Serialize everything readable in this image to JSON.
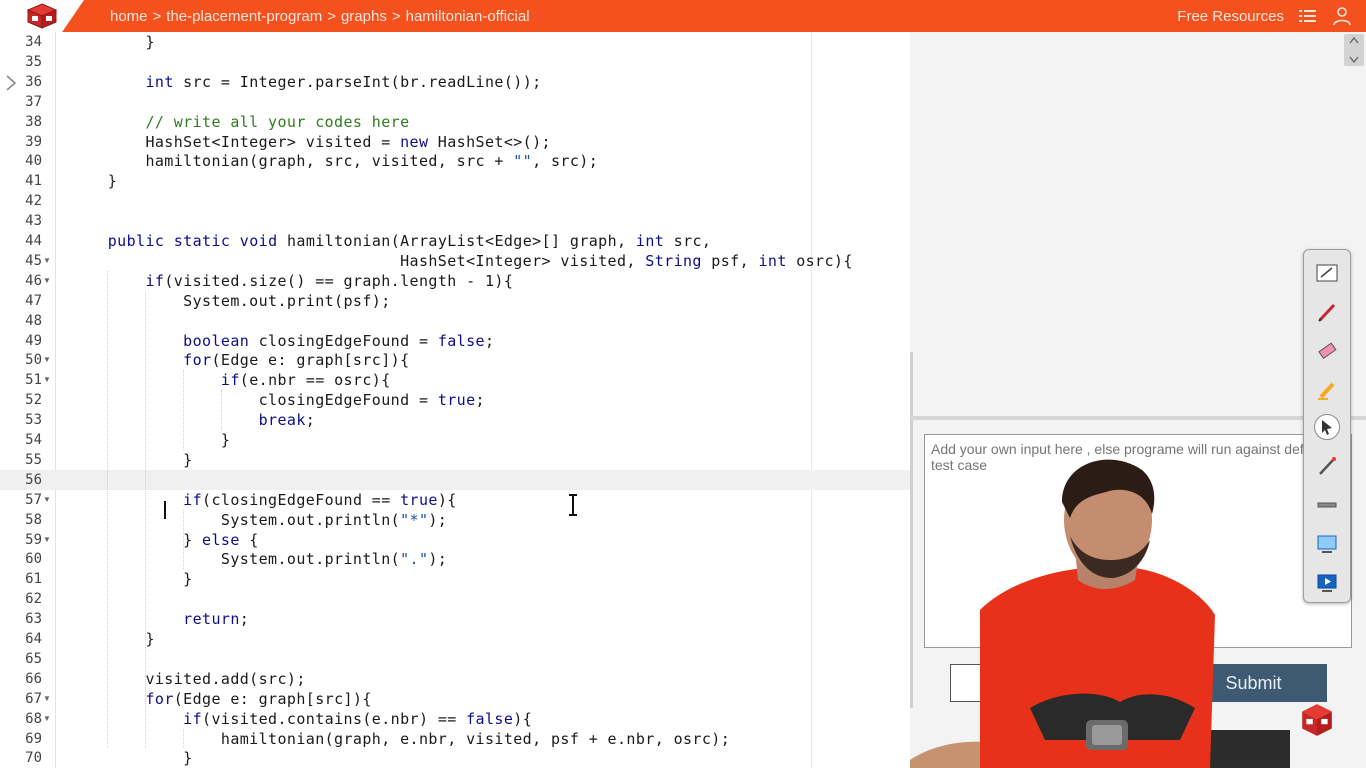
{
  "breadcrumb": {
    "items": [
      "home",
      "the-placement-program",
      "graphs",
      "hamiltonian-official"
    ],
    "separator": ">"
  },
  "header": {
    "free_resources_label": "Free Resources",
    "list_icon": "list-menu-icon",
    "profile_icon": "user-profile-icon",
    "logo_icon": "pepcoding-cube-logo"
  },
  "colors": {
    "topbar": "#f4511e",
    "keyword": "#0d0d8a",
    "comment": "#2e7d1e",
    "string": "#1a4fa8",
    "submit": "#3e5a73"
  },
  "editor": {
    "active_line": 56,
    "lines": [
      {
        "n": "34",
        "text": "        }"
      },
      {
        "n": "35",
        "text": ""
      },
      {
        "n": "36",
        "text": "        int src = Integer.parseInt(br.readLine());"
      },
      {
        "n": "37",
        "text": ""
      },
      {
        "n": "38",
        "text": "        // write all your codes here"
      },
      {
        "n": "39",
        "text": "        HashSet<Integer> visited = new HashSet<>();"
      },
      {
        "n": "40",
        "text": "        hamiltonian(graph, src, visited, src + \"\", src);"
      },
      {
        "n": "41",
        "text": "    }"
      },
      {
        "n": "42",
        "text": ""
      },
      {
        "n": "43",
        "text": ""
      },
      {
        "n": "44",
        "text": "    public static void hamiltonian(ArrayList<Edge>[] graph, int src,"
      },
      {
        "n": "45",
        "text": "                                   HashSet<Integer> visited, String psf, int osrc){"
      },
      {
        "n": "46",
        "text": "        if(visited.size() == graph.length - 1){"
      },
      {
        "n": "47",
        "text": "            System.out.print(psf);"
      },
      {
        "n": "48",
        "text": ""
      },
      {
        "n": "49",
        "text": "            boolean closingEdgeFound = false;"
      },
      {
        "n": "50",
        "text": "            for(Edge e: graph[src]){"
      },
      {
        "n": "51",
        "text": "                if(e.nbr == osrc){"
      },
      {
        "n": "52",
        "text": "                    closingEdgeFound = true;"
      },
      {
        "n": "53",
        "text": "                    break;"
      },
      {
        "n": "54",
        "text": "                }"
      },
      {
        "n": "55",
        "text": "            }"
      },
      {
        "n": "56",
        "text": ""
      },
      {
        "n": "57",
        "text": "            if(closingEdgeFound == true){"
      },
      {
        "n": "58",
        "text": "                System.out.println(\"*\");"
      },
      {
        "n": "59",
        "text": "            } else {"
      },
      {
        "n": "60",
        "text": "                System.out.println(\".\");"
      },
      {
        "n": "61",
        "text": "            }"
      },
      {
        "n": "62",
        "text": ""
      },
      {
        "n": "63",
        "text": "            return;"
      },
      {
        "n": "64",
        "text": "        }"
      },
      {
        "n": "65",
        "text": ""
      },
      {
        "n": "66",
        "text": "        visited.add(src);"
      },
      {
        "n": "67",
        "text": "        for(Edge e: graph[src]){"
      },
      {
        "n": "68",
        "text": "            if(visited.contains(e.nbr) == false){"
      },
      {
        "n": "69",
        "text": "                hamiltonian(graph, e.nbr, visited, psf + e.nbr, osrc);"
      },
      {
        "n": "70",
        "text": "            }"
      }
    ],
    "fold_lines": [
      "45",
      "46",
      "50",
      "51",
      "57",
      "59",
      "67",
      "68"
    ]
  },
  "input_panel": {
    "placeholder": "Add your own input here , else programe will run against default test case",
    "value": ""
  },
  "buttons": {
    "submit_label": "Submit",
    "run_label": ""
  },
  "annotation_toolbar": {
    "tools": [
      "whiteboard-icon",
      "pen-icon",
      "eraser-icon",
      "highlighter-icon",
      "pointer-icon",
      "laser-pen-icon",
      "line-icon",
      "screen-capture-icon",
      "screen-record-icon"
    ],
    "selected": "pointer-icon"
  }
}
